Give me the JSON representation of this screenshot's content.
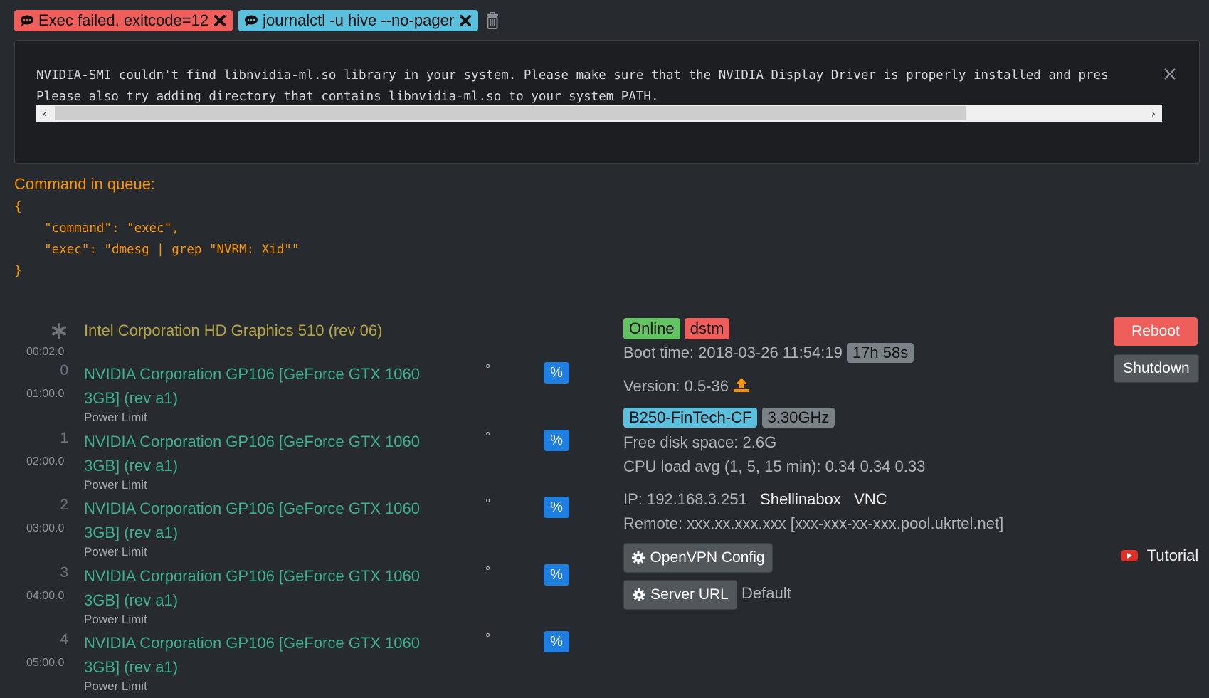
{
  "tabs": [
    {
      "label": "Exec failed, exitcode=12",
      "color": "#ee5f5b"
    },
    {
      "label": "journalctl -u hive --no-pager",
      "color": "#5bc0de"
    }
  ],
  "console": {
    "lines": [
      "NVIDIA-SMI couldn't find libnvidia-ml.so library in your system. Please make sure that the NVIDIA Display Driver is properly installed and pres",
      "Please also try adding directory that contains libnvidia-ml.so to your system PATH."
    ]
  },
  "queue": {
    "label": "Command in queue:",
    "json": "{\n    \"command\": \"exec\",\n    \"exec\": \"dmesg | grep \"NVRM: Xid\"\"\n}"
  },
  "gpus": [
    {
      "index": "",
      "bus": "00:02.0",
      "name": "Intel Corporation HD Graphics 510 (rev 06)",
      "type": "intel"
    },
    {
      "index": "0",
      "bus": "01:00.0",
      "name": "NVIDIA Corporation GP106 [GeForce GTX 1060 3GB] (rev a1)",
      "degree": "°",
      "percent": "%",
      "power_limit": "Power Limit"
    },
    {
      "index": "1",
      "bus": "02:00.0",
      "name": "NVIDIA Corporation GP106 [GeForce GTX 1060 3GB] (rev a1)",
      "degree": "°",
      "percent": "%",
      "power_limit": "Power Limit"
    },
    {
      "index": "2",
      "bus": "03:00.0",
      "name": "NVIDIA Corporation GP106 [GeForce GTX 1060 3GB] (rev a1)",
      "degree": "°",
      "percent": "%",
      "power_limit": "Power Limit"
    },
    {
      "index": "3",
      "bus": "04:00.0",
      "name": "NVIDIA Corporation GP106 [GeForce GTX 1060 3GB] (rev a1)",
      "degree": "°",
      "percent": "%",
      "power_limit": "Power Limit"
    },
    {
      "index": "4",
      "bus": "05:00.0",
      "name": "NVIDIA Corporation GP106 [GeForce GTX 1060 3GB] (rev a1)",
      "degree": "°",
      "percent": "%",
      "power_limit": "Power Limit"
    }
  ],
  "status": {
    "online": "Online",
    "miner": "dstm",
    "boot_label": "Boot time: 2018-03-26 11:54:19",
    "uptime": "17h 58s",
    "version": "Version: 0.5-36",
    "motherboard": "B250-FinTech-CF",
    "cpu_freq": "3.30GHz",
    "disk": "Free disk space: 2.6G",
    "cpu_load": "CPU load avg (1, 5, 15 min): 0.34 0.34 0.33",
    "ip": "IP: 192.168.3.251",
    "shellinabox": "Shellinabox",
    "vnc": "VNC",
    "remote": "Remote: xxx.xx.xxx.xxx [xxx-xxx-xx-xxx.pool.ukrtel.net]",
    "openvpn": "OpenVPN Config",
    "server_url": "Server URL",
    "server_default": "Default"
  },
  "actions": {
    "reboot": "Reboot",
    "shutdown": "Shutdown",
    "tutorial": "Tutorial"
  },
  "colors": {
    "background": "#272b30",
    "success": "#62c462",
    "danger": "#ee5f5b",
    "info": "#5bc0de",
    "warning": "#f89406",
    "gpu_name": "#3cb08f",
    "igpu_name": "#b5a642",
    "primary": "#1f7fe0"
  },
  "icons": [
    "comment-icon",
    "close-x-icon",
    "trash-icon",
    "asterisk-icon",
    "upload-icon",
    "gear-icon",
    "youtube-icon"
  ]
}
